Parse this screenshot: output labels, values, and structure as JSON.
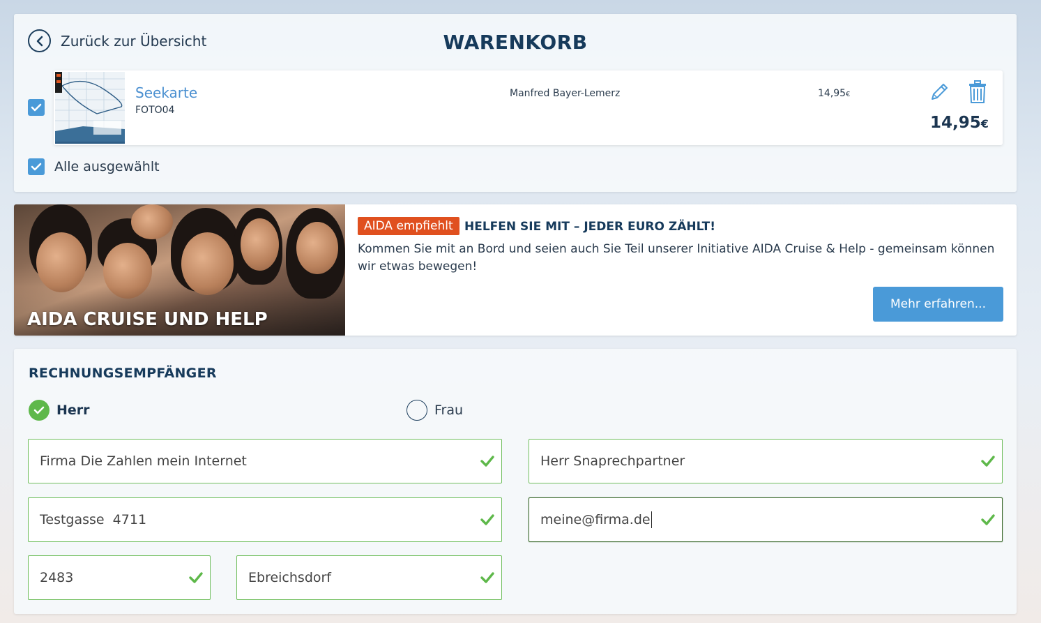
{
  "cart": {
    "back_label": "Zurück zur Übersicht",
    "title": "WARENKORB",
    "items": [
      {
        "name": "Seekarte",
        "code": "FOTO04",
        "author": "Manfred Bayer-Lemerz",
        "unit_price": "14,95",
        "unit_currency": "€",
        "total": "14,95",
        "total_currency": "€",
        "selected": true
      }
    ],
    "select_all_label": "Alle ausgewählt"
  },
  "promo": {
    "image_caption": "AIDA CRUISE UND HELP",
    "badge": "AIDA empfiehlt",
    "heading": "HELFEN SIE MIT – JEDER EURO ZÄHLT!",
    "text": "Kommen Sie mit an Bord und seien auch Sie Teil unserer Initiative AIDA Cruise & Help - gemeinsam können wir etwas bewegen!",
    "button_label": "Mehr erfahren..."
  },
  "billing": {
    "title": "RECHNUNGSEMPFÄNGER",
    "salutation_options": [
      {
        "label": "Herr",
        "selected": true
      },
      {
        "label": "Frau",
        "selected": false
      }
    ],
    "fields": {
      "company": "Firma Die Zahlen mein Internet",
      "contact": "Herr Snaprechpartner",
      "street": "Testgasse  4711",
      "email": "meine@firma.de",
      "zip": "2483",
      "city": "Ebreichsdorf"
    }
  },
  "colors": {
    "accent_blue": "#4a9ad8",
    "badge_orange": "#e0501f",
    "valid_green": "#5eb84a",
    "heading_navy": "#163a5b"
  },
  "icons": {
    "back": "chevron-left-circle-icon",
    "edit": "pencil-icon",
    "delete": "trash-icon",
    "valid": "checkmark-icon"
  }
}
